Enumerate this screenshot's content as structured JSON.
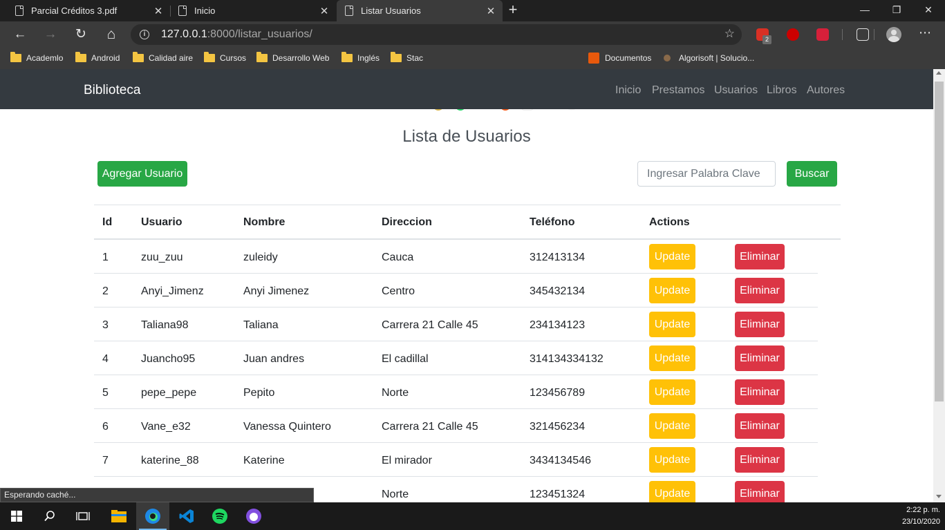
{
  "browser": {
    "tabs": [
      {
        "title": "Parcial Créditos 3.pdf",
        "close": "✕"
      },
      {
        "title": "Inicio",
        "close": "✕"
      },
      {
        "title": "Listar Usuarios",
        "close": "✕"
      }
    ],
    "new_tab": "+",
    "window_controls": {
      "minimize": "—",
      "maximize": "❐",
      "close": "✕"
    },
    "nav": {
      "back": "←",
      "forward": "→",
      "refresh": "↻",
      "home": "⌂"
    },
    "address": {
      "host": "127.0.0.1",
      "rest": ":8000/listar_usuarios/"
    },
    "favorite_icon": "☆",
    "extension_badge": "2",
    "more": "⋯",
    "bookmarks": {
      "academlo": "Academlo",
      "android": "Android",
      "calidad_aire": "Calidad aire",
      "cursos": "Cursos",
      "desarrollo_web": "Desarrollo Web",
      "ingles": "Inglés",
      "stac": "Stac",
      "documentos": "Documentos",
      "algorisoft": "Algorisoft | Solucio..."
    },
    "status_text": "Esperando caché..."
  },
  "app": {
    "brand": "Biblioteca",
    "nav": {
      "inicio": "Inicio",
      "prestamos": "Prestamos",
      "usuarios": "Usuarios",
      "libros": "Libros",
      "autores": "Autores"
    },
    "page_title": "Lista de Usuarios",
    "add_button": "Agregar Usuario",
    "search_placeholder": "Ingresar Palabra Clave",
    "search_button": "Buscar",
    "table": {
      "headers": {
        "id": "Id",
        "usuario": "Usuario",
        "nombre": "Nombre",
        "direccion": "Direccion",
        "telefono": "Teléfono",
        "actions": "Actions"
      },
      "update_label": "Update",
      "delete_label": "Eliminar",
      "rows": [
        {
          "id": "1",
          "usuario": "zuu_zuu",
          "nombre": "zuleidy",
          "direccion": "Cauca",
          "telefono": "312413134"
        },
        {
          "id": "2",
          "usuario": "Anyi_Jimenz",
          "nombre": "Anyi Jimenez",
          "direccion": "Centro",
          "telefono": "345432134"
        },
        {
          "id": "3",
          "usuario": "Taliana98",
          "nombre": "Taliana",
          "direccion": "Carrera 21 Calle 45",
          "telefono": "234134123"
        },
        {
          "id": "4",
          "usuario": "Juancho95",
          "nombre": "Juan andres",
          "direccion": "El cadillal",
          "telefono": "314134334132"
        },
        {
          "id": "5",
          "usuario": "pepe_pepe",
          "nombre": "Pepito",
          "direccion": "Norte",
          "telefono": "123456789"
        },
        {
          "id": "6",
          "usuario": "Vane_e32",
          "nombre": "Vanessa Quintero",
          "direccion": "Carrera 21 Calle 45",
          "telefono": "321456234"
        },
        {
          "id": "7",
          "usuario": "katerine_88",
          "nombre": "Katerine",
          "direccion": "El mirador",
          "telefono": "3434134546"
        },
        {
          "id": "",
          "usuario": "",
          "nombre": "",
          "direccion": "Norte",
          "telefono": "123451324"
        }
      ]
    }
  },
  "taskbar": {
    "time": "2:22 p. m.",
    "date": "23/10/2020"
  },
  "colors": {
    "navbar": "#343a40",
    "success": "#28a745",
    "warning": "#ffc107",
    "danger": "#dc3545"
  }
}
